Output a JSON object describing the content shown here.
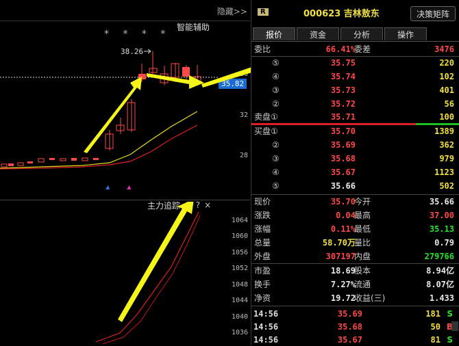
{
  "chart_pane": {
    "hide_label": "隐藏>>",
    "smart_helper": "智能辅助",
    "stars": "* * * *",
    "peak_label": "38.26",
    "price_flag": "35.82",
    "upper_axis": [
      "36",
      "32",
      "28"
    ],
    "lower_panel_title": "主力追踪",
    "lower_panel_icons": {
      "settings": "gear-icon",
      "help": "?",
      "close": "×"
    },
    "lower_axis": [
      "1064",
      "1060",
      "1056",
      "1052",
      "1048",
      "1044",
      "1040",
      "1036"
    ]
  },
  "header": {
    "badge": "R",
    "code_name": "000623 吉林敖东",
    "decide_button": "决策矩阵"
  },
  "tabs": [
    "报价",
    "资金",
    "分析",
    "操作"
  ],
  "weibi": {
    "label": "委比",
    "value": "66.41%",
    "label2": "委差",
    "value2": "3476"
  },
  "sell_levels": [
    {
      "label": "⑤",
      "price": "35.75",
      "vol": "220"
    },
    {
      "label": "④",
      "price": "35.74",
      "vol": "102"
    },
    {
      "label": "③",
      "price": "35.73",
      "vol": "401"
    },
    {
      "label": "②",
      "price": "35.72",
      "vol": "56"
    },
    {
      "label": "卖盘①",
      "price": "35.71",
      "vol": "100"
    }
  ],
  "buy_levels": [
    {
      "label": "买盘①",
      "price": "35.70",
      "vol": "1389"
    },
    {
      "label": "②",
      "price": "35.69",
      "vol": "362"
    },
    {
      "label": "③",
      "price": "35.68",
      "vol": "979"
    },
    {
      "label": "④",
      "price": "35.67",
      "vol": "1123"
    },
    {
      "label": "⑤",
      "price": "35.66",
      "vol": "502"
    }
  ],
  "stats": [
    {
      "k1": "现价",
      "v1": "35.70",
      "k2": "今开",
      "v2": "35.66"
    },
    {
      "k1": "涨跌",
      "v1": "0.04",
      "k2": "最高",
      "v2": "37.00"
    },
    {
      "k1": "涨幅",
      "v1": "0.11%",
      "k2": "最低",
      "v2": "35.13"
    },
    {
      "k1": "总量",
      "v1": "58.70万",
      "k2": "量比",
      "v2": "0.79"
    },
    {
      "k1": "外盘",
      "v1": "307197",
      "k2": "内盘",
      "v2": "279766"
    }
  ],
  "stats2": [
    {
      "k1": "市盈",
      "v1": "18.69",
      "k2": "股本",
      "v2": "8.94亿"
    },
    {
      "k1": "换手",
      "v1": "7.27%",
      "k2": "流通",
      "v2": "8.07亿"
    },
    {
      "k1": "净资",
      "v1": "19.72",
      "k2": "收益(三)",
      "v2": "1.433"
    }
  ],
  "ticks": [
    {
      "time": "14:56",
      "price": "35.69",
      "vol": "181",
      "dir": "S"
    },
    {
      "time": "14:56",
      "price": "35.68",
      "vol": "50",
      "dir": "B"
    },
    {
      "time": "14:56",
      "price": "35.67",
      "vol": "81",
      "dir": "S"
    }
  ],
  "colors": {
    "up": "#ff4848",
    "down": "#28e028",
    "neutral": "#f0e040",
    "accent": "#1a6bd6"
  }
}
